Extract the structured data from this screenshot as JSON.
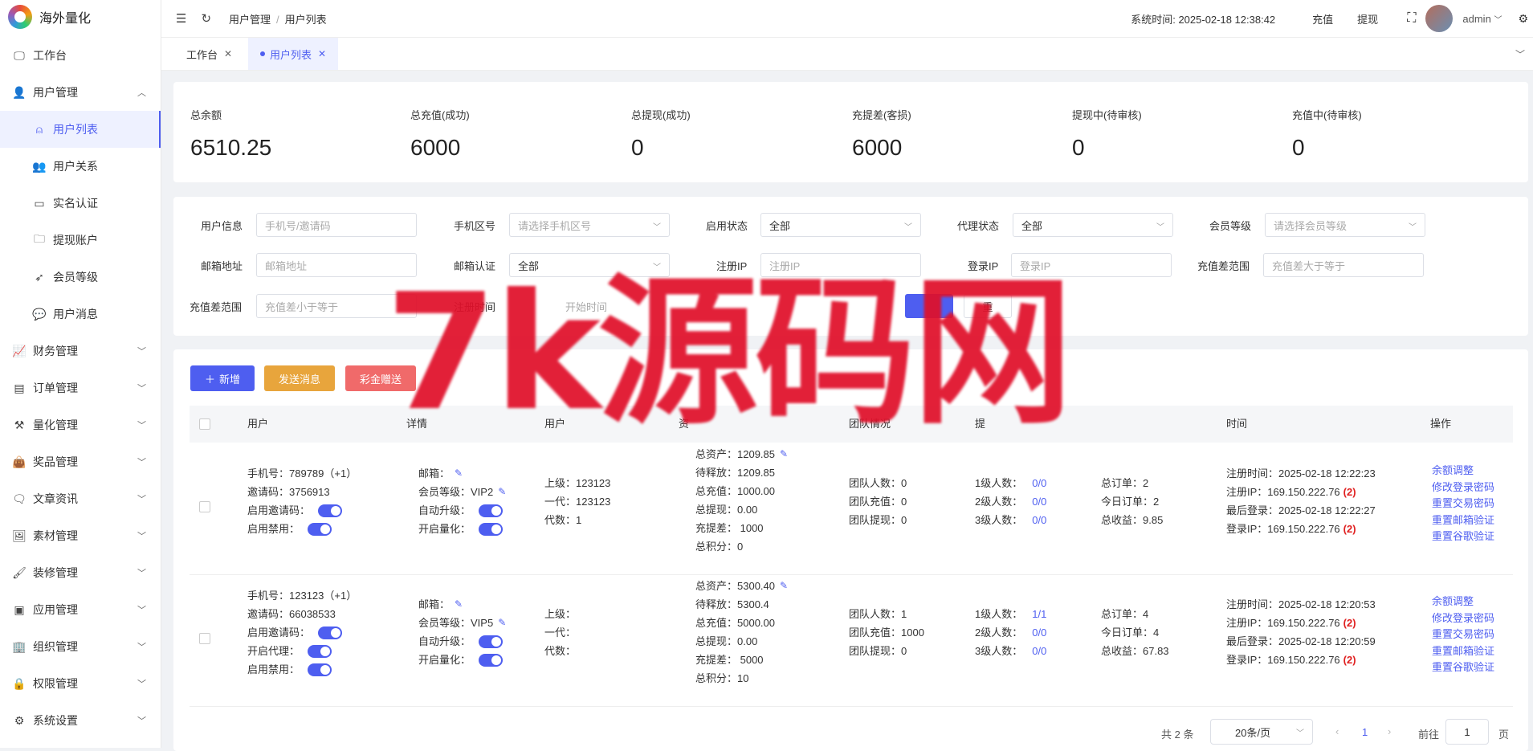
{
  "app": {
    "name": "海外量化"
  },
  "sidebar": {
    "items": [
      {
        "label": "工作台"
      },
      {
        "label": "用户管理"
      },
      {
        "label": "用户列表"
      },
      {
        "label": "用户关系"
      },
      {
        "label": "实名认证"
      },
      {
        "label": "提现账户"
      },
      {
        "label": "会员等级"
      },
      {
        "label": "用户消息"
      },
      {
        "label": "财务管理"
      },
      {
        "label": "订单管理"
      },
      {
        "label": "量化管理"
      },
      {
        "label": "奖品管理"
      },
      {
        "label": "文章资讯"
      },
      {
        "label": "素材管理"
      },
      {
        "label": "装修管理"
      },
      {
        "label": "应用管理"
      },
      {
        "label": "组织管理"
      },
      {
        "label": "权限管理"
      },
      {
        "label": "系统设置"
      }
    ]
  },
  "header": {
    "breadcrumb": [
      "用户管理",
      "用户列表"
    ],
    "system_time": "系统时间: 2025-02-18 12:38:42",
    "recharge": "充值",
    "withdraw": "提现",
    "user": "admin"
  },
  "tabs": [
    {
      "label": "工作台"
    },
    {
      "label": "用户列表"
    }
  ],
  "stats": [
    {
      "label": "总余额",
      "value": "6510.25"
    },
    {
      "label": "总充值(成功)",
      "value": "6000"
    },
    {
      "label": "总提现(成功)",
      "value": "0"
    },
    {
      "label": "充提差(客损)",
      "value": "6000"
    },
    {
      "label": "提现中(待审核)",
      "value": "0"
    },
    {
      "label": "充值中(待审核)",
      "value": "0"
    }
  ],
  "filters": {
    "user_info": {
      "label": "用户信息",
      "placeholder": "手机号/邀请码"
    },
    "phone_area": {
      "label": "手机区号",
      "placeholder": "请选择手机区号"
    },
    "enable_status": {
      "label": "启用状态",
      "value": "全部"
    },
    "agent_status": {
      "label": "代理状态",
      "value": "全部"
    },
    "member_level": {
      "label": "会员等级",
      "placeholder": "请选择会员等级"
    },
    "email": {
      "label": "邮箱地址",
      "placeholder": "邮箱地址"
    },
    "email_verify": {
      "label": "邮箱认证",
      "value": "全部"
    },
    "reg_ip": {
      "label": "注册IP",
      "placeholder": "注册IP"
    },
    "login_ip": {
      "label": "登录IP",
      "placeholder": "登录IP"
    },
    "diff_range_min": {
      "label": "充值差范围",
      "placeholder": "充值差大于等于"
    },
    "diff_range_max": {
      "label": "充值差范围",
      "placeholder": "充值差小于等于"
    },
    "reg_time": {
      "label": "注册时间",
      "placeholder": "开始时间"
    },
    "reset": "重"
  },
  "actions": {
    "add": "新增",
    "send_msg": "发送消息",
    "gift": "彩金赠送"
  },
  "columns": [
    "用户",
    "详情",
    "用户",
    "资",
    "团队情况",
    "提",
    "",
    "时间",
    "操作"
  ],
  "rows": [
    {
      "user": {
        "phone": "手机号：789789（+1）",
        "invite": "邀请码：3756913",
        "l3": "启用邀请码：",
        "l4": "启用禁用："
      },
      "detail": {
        "email": "邮箱：",
        "level": "会员等级：VIP2",
        "auto": "自动升级：",
        "quant": "开启量化："
      },
      "rel": {
        "parent": "上级：123123",
        "gen1": "一代：123123",
        "gens": "代数：1"
      },
      "assets": {
        "total": "总资产：1209.85",
        "pending": "待释放：1209.85",
        "recharge": "总充值：1000.00",
        "withdraw": "总提现：0.00",
        "diff": "充提差：  1000",
        "points": "总积分：0"
      },
      "team": {
        "count": "团队人数：0",
        "recharge": "团队充值：0",
        "withdraw": "团队提现：0"
      },
      "levels": [
        {
          "label": "1级人数：",
          "value": "0/0"
        },
        {
          "label": "2级人数：",
          "value": "0/0"
        },
        {
          "label": "3级人数：",
          "value": "0/0"
        }
      ],
      "orders": {
        "total": "总订单：2",
        "today": "今日订单：2",
        "income": "总收益：9.85"
      },
      "time": {
        "reg": "注册时间：2025-02-18 12:22:23",
        "reg_ip": "注册IP：169.150.222.76",
        "last": "最后登录：2025-02-18 12:22:27",
        "login_ip": "登录IP：169.150.222.76",
        "reg_ip_count": "(2)",
        "login_ip_count": "(2)"
      }
    },
    {
      "user": {
        "phone": "手机号：123123（+1）",
        "invite": "邀请码：66038533",
        "l3": "启用邀请码：",
        "l4": "开启代理：",
        "l5": "启用禁用："
      },
      "detail": {
        "email": "邮箱：",
        "level": "会员等级：VIP5",
        "auto": "自动升级：",
        "quant": "开启量化："
      },
      "rel": {
        "parent": "上级：",
        "gen1": "一代：",
        "gens": "代数："
      },
      "assets": {
        "total": "总资产：5300.40",
        "pending": "待释放：5300.4",
        "recharge": "总充值：5000.00",
        "withdraw": "总提现：0.00",
        "diff": "充提差：  5000",
        "points": "总积分：10"
      },
      "team": {
        "count": "团队人数：1",
        "recharge": "团队充值：1000",
        "withdraw": "团队提现：0"
      },
      "levels": [
        {
          "label": "1级人数：",
          "value": "1/1"
        },
        {
          "label": "2级人数：",
          "value": "0/0"
        },
        {
          "label": "3级人数：",
          "value": "0/0"
        }
      ],
      "orders": {
        "total": "总订单：4",
        "today": "今日订单：4",
        "income": "总收益：67.83"
      },
      "time": {
        "reg": "注册时间：2025-02-18 12:20:53",
        "reg_ip": "注册IP：169.150.222.76",
        "last": "最后登录：2025-02-18 12:20:59",
        "login_ip": "登录IP：169.150.222.76",
        "reg_ip_count": "(2)",
        "login_ip_count": "(2)"
      }
    }
  ],
  "operations": [
    "余额调整",
    "修改登录密码",
    "重置交易密码",
    "重置邮箱验证",
    "重置谷歌验证"
  ],
  "pagination": {
    "total": "共 2 条",
    "page_size": "20条/页",
    "current": "1",
    "goto": "前往",
    "page_input": "1",
    "page_unit": "页"
  },
  "watermark": "7k源码网"
}
